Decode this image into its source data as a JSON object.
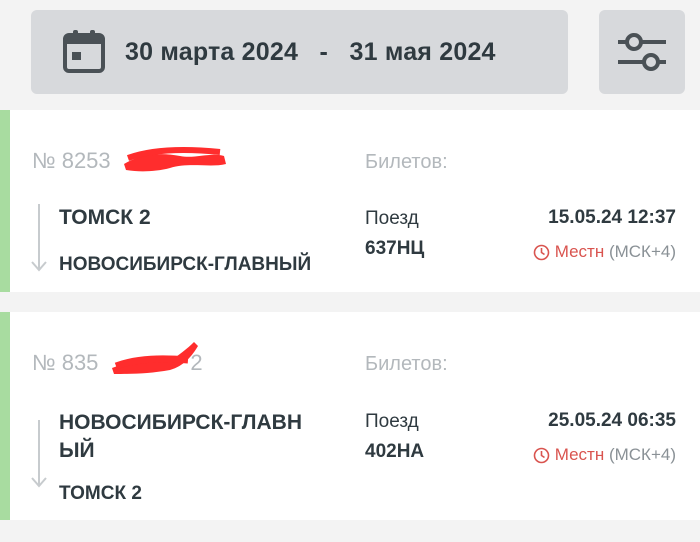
{
  "filter": {
    "date_from": "30 марта 2024",
    "date_separator": "-",
    "date_to": "31 мая 2024",
    "icon_calendar": "calendar-icon",
    "icon_filter": "sliders-icon"
  },
  "orders": [
    {
      "number": "№ 8253",
      "tickets_label": "Билетов:",
      "from": "ТОМСК 2",
      "to": "НОВОСИБИРСК-ГЛАВНЫЙ",
      "train_label": "Поезд",
      "train_number": "637НЦ",
      "datetime": "15.05.24 12:37",
      "tz_local": "Местн",
      "tz_msk": "(МСК+4)"
    },
    {
      "number": "№ 835",
      "number_tail": "2",
      "tickets_label": "Билетов:",
      "from_line1": "НОВОСИБИРСК-ГЛАВН",
      "from_line2": "ЫЙ",
      "to": "ТОМСК 2",
      "train_label": "Поезд",
      "train_number": "402НА",
      "datetime": "25.05.24 06:35",
      "tz_local": "Местн",
      "tz_msk": "(МСК+4)"
    }
  ],
  "colors": {
    "accent_green": "#a8dca0",
    "local_time_red": "#d9544f",
    "panel_gray": "#d7d9dc"
  }
}
